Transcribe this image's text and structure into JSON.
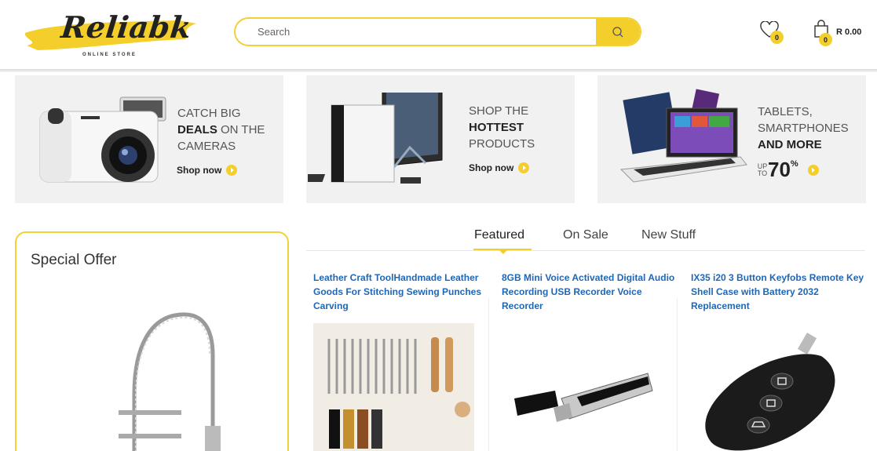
{
  "header": {
    "logo_text": "Reliabk",
    "logo_subtitle": "ONLINE STORE",
    "search_placeholder": "Search",
    "wishlist_count": "0",
    "cart_count": "0",
    "cart_total": "R 0.00"
  },
  "colors": {
    "accent": "#f4cf2c",
    "link": "#1f66b5",
    "banner_bg": "#f1f1f1"
  },
  "banners": [
    {
      "line1": "CATCH BIG",
      "line2_bold": "DEALS",
      "line2_rest": " ON THE",
      "line3": "CAMERAS",
      "cta": "Shop now"
    },
    {
      "line1": "SHOP THE",
      "line2_bold": "HOTTEST",
      "line3": "PRODUCTS",
      "cta": "Shop now"
    },
    {
      "line1": "TABLETS,",
      "line2": "SMARTPHONES",
      "line3_bold": "AND MORE",
      "upto": "UP TO",
      "percent": "70",
      "percent_sign": "%"
    }
  ],
  "special_offer": {
    "title": "Special Offer"
  },
  "tabs": [
    {
      "label": "Featured",
      "active": true
    },
    {
      "label": "On Sale",
      "active": false
    },
    {
      "label": "New Stuff",
      "active": false
    }
  ],
  "products": [
    {
      "title": "Leather Craft ToolHandmade Leather Goods For Stitching Sewing Punches Carving"
    },
    {
      "title": "8GB Mini Voice Activated Digital Audio Recording USB Recorder Voice Recorder"
    },
    {
      "title": "IX35 i20 3 Button Keyfobs Remote Key Shell Case with Battery 2032 Replacement"
    }
  ]
}
